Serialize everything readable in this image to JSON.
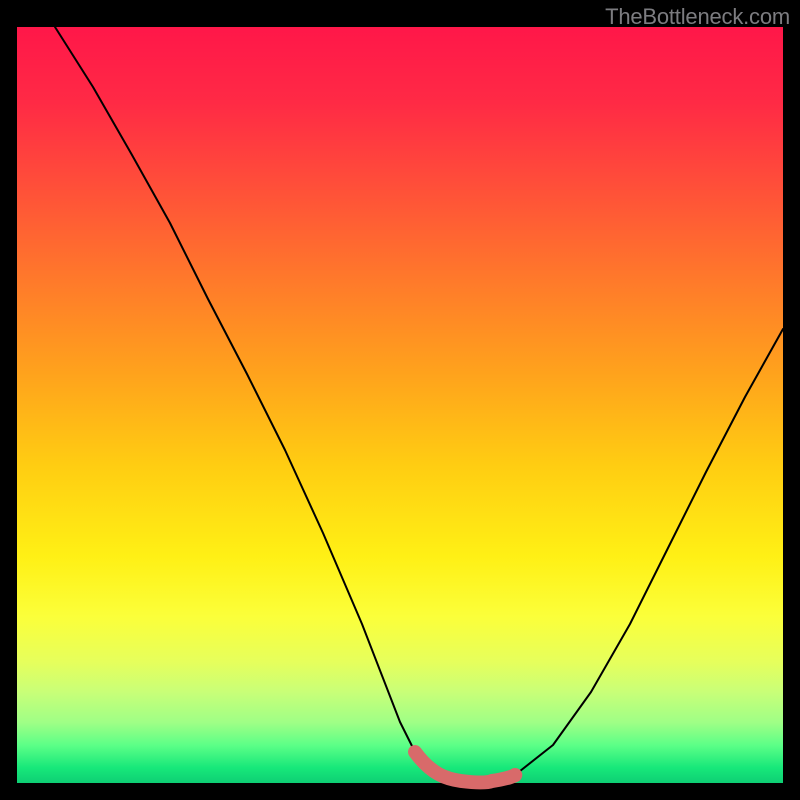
{
  "watermark": "TheBottleneck.com",
  "chart_data": {
    "type": "line",
    "title": "",
    "xlabel": "",
    "ylabel": "",
    "xlim": [
      0,
      100
    ],
    "ylim": [
      0,
      100
    ],
    "grid": false,
    "legend": false,
    "annotations": [],
    "series": [
      {
        "name": "bottleneck-curve",
        "color": "#000000",
        "x": [
          5,
          10,
          15,
          20,
          25,
          30,
          35,
          40,
          45,
          50,
          52,
          55,
          58,
          62,
          65,
          70,
          75,
          80,
          85,
          90,
          95,
          100
        ],
        "y": [
          100,
          92,
          83,
          74,
          64,
          54,
          44,
          33,
          21,
          8,
          4,
          1,
          0,
          0,
          1,
          5,
          12,
          21,
          31,
          41,
          51,
          60
        ]
      },
      {
        "name": "optimal-region",
        "color": "#d86a6a",
        "x": [
          52,
          55,
          58,
          60,
          62,
          65
        ],
        "y": [
          4,
          1,
          0,
          0,
          0,
          1
        ]
      }
    ]
  }
}
